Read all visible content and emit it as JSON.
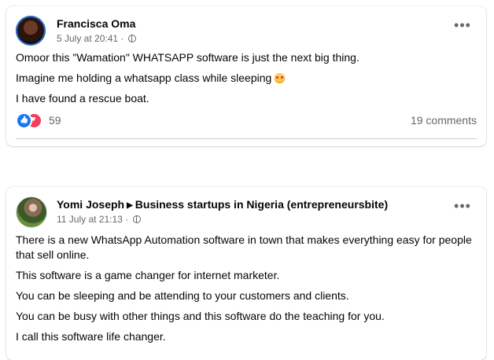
{
  "posts": [
    {
      "author": "Francisca Oma",
      "timestamp": "5 July at 20:41 ·",
      "more_label": "•••",
      "lines": [
        "Omoor this \"Wamation\" WHATSAPP software is just the next big thing.",
        "Imagine me holding a whatsapp class while sleeping",
        "I have found a rescue boat."
      ],
      "reaction_count": "59",
      "comments_label": "19 comments"
    },
    {
      "author": "Yomi Joseph",
      "group": "Business startups in Nigeria (entrepreneursbite)",
      "timestamp": "11 July at 21:13 ·",
      "more_label": "•••",
      "lines": [
        "There is a new WhatsApp Automation software in town that makes everything easy for people that sell online.",
        "This software is a game changer for internet marketer.",
        "You can be sleeping and be attending to your customers and clients.",
        "You can be busy with other things and this software do the teaching for you.",
        "I call this software life changer."
      ]
    }
  ],
  "colors": {
    "accent": "#1877f2",
    "love": "#f33e58",
    "muted": "#65676b"
  },
  "icons": [
    "avatar",
    "globe-icon",
    "more-options-icon",
    "like-reaction-icon",
    "love-reaction-icon",
    "emoji-face-icon",
    "group-arrow-icon"
  ]
}
